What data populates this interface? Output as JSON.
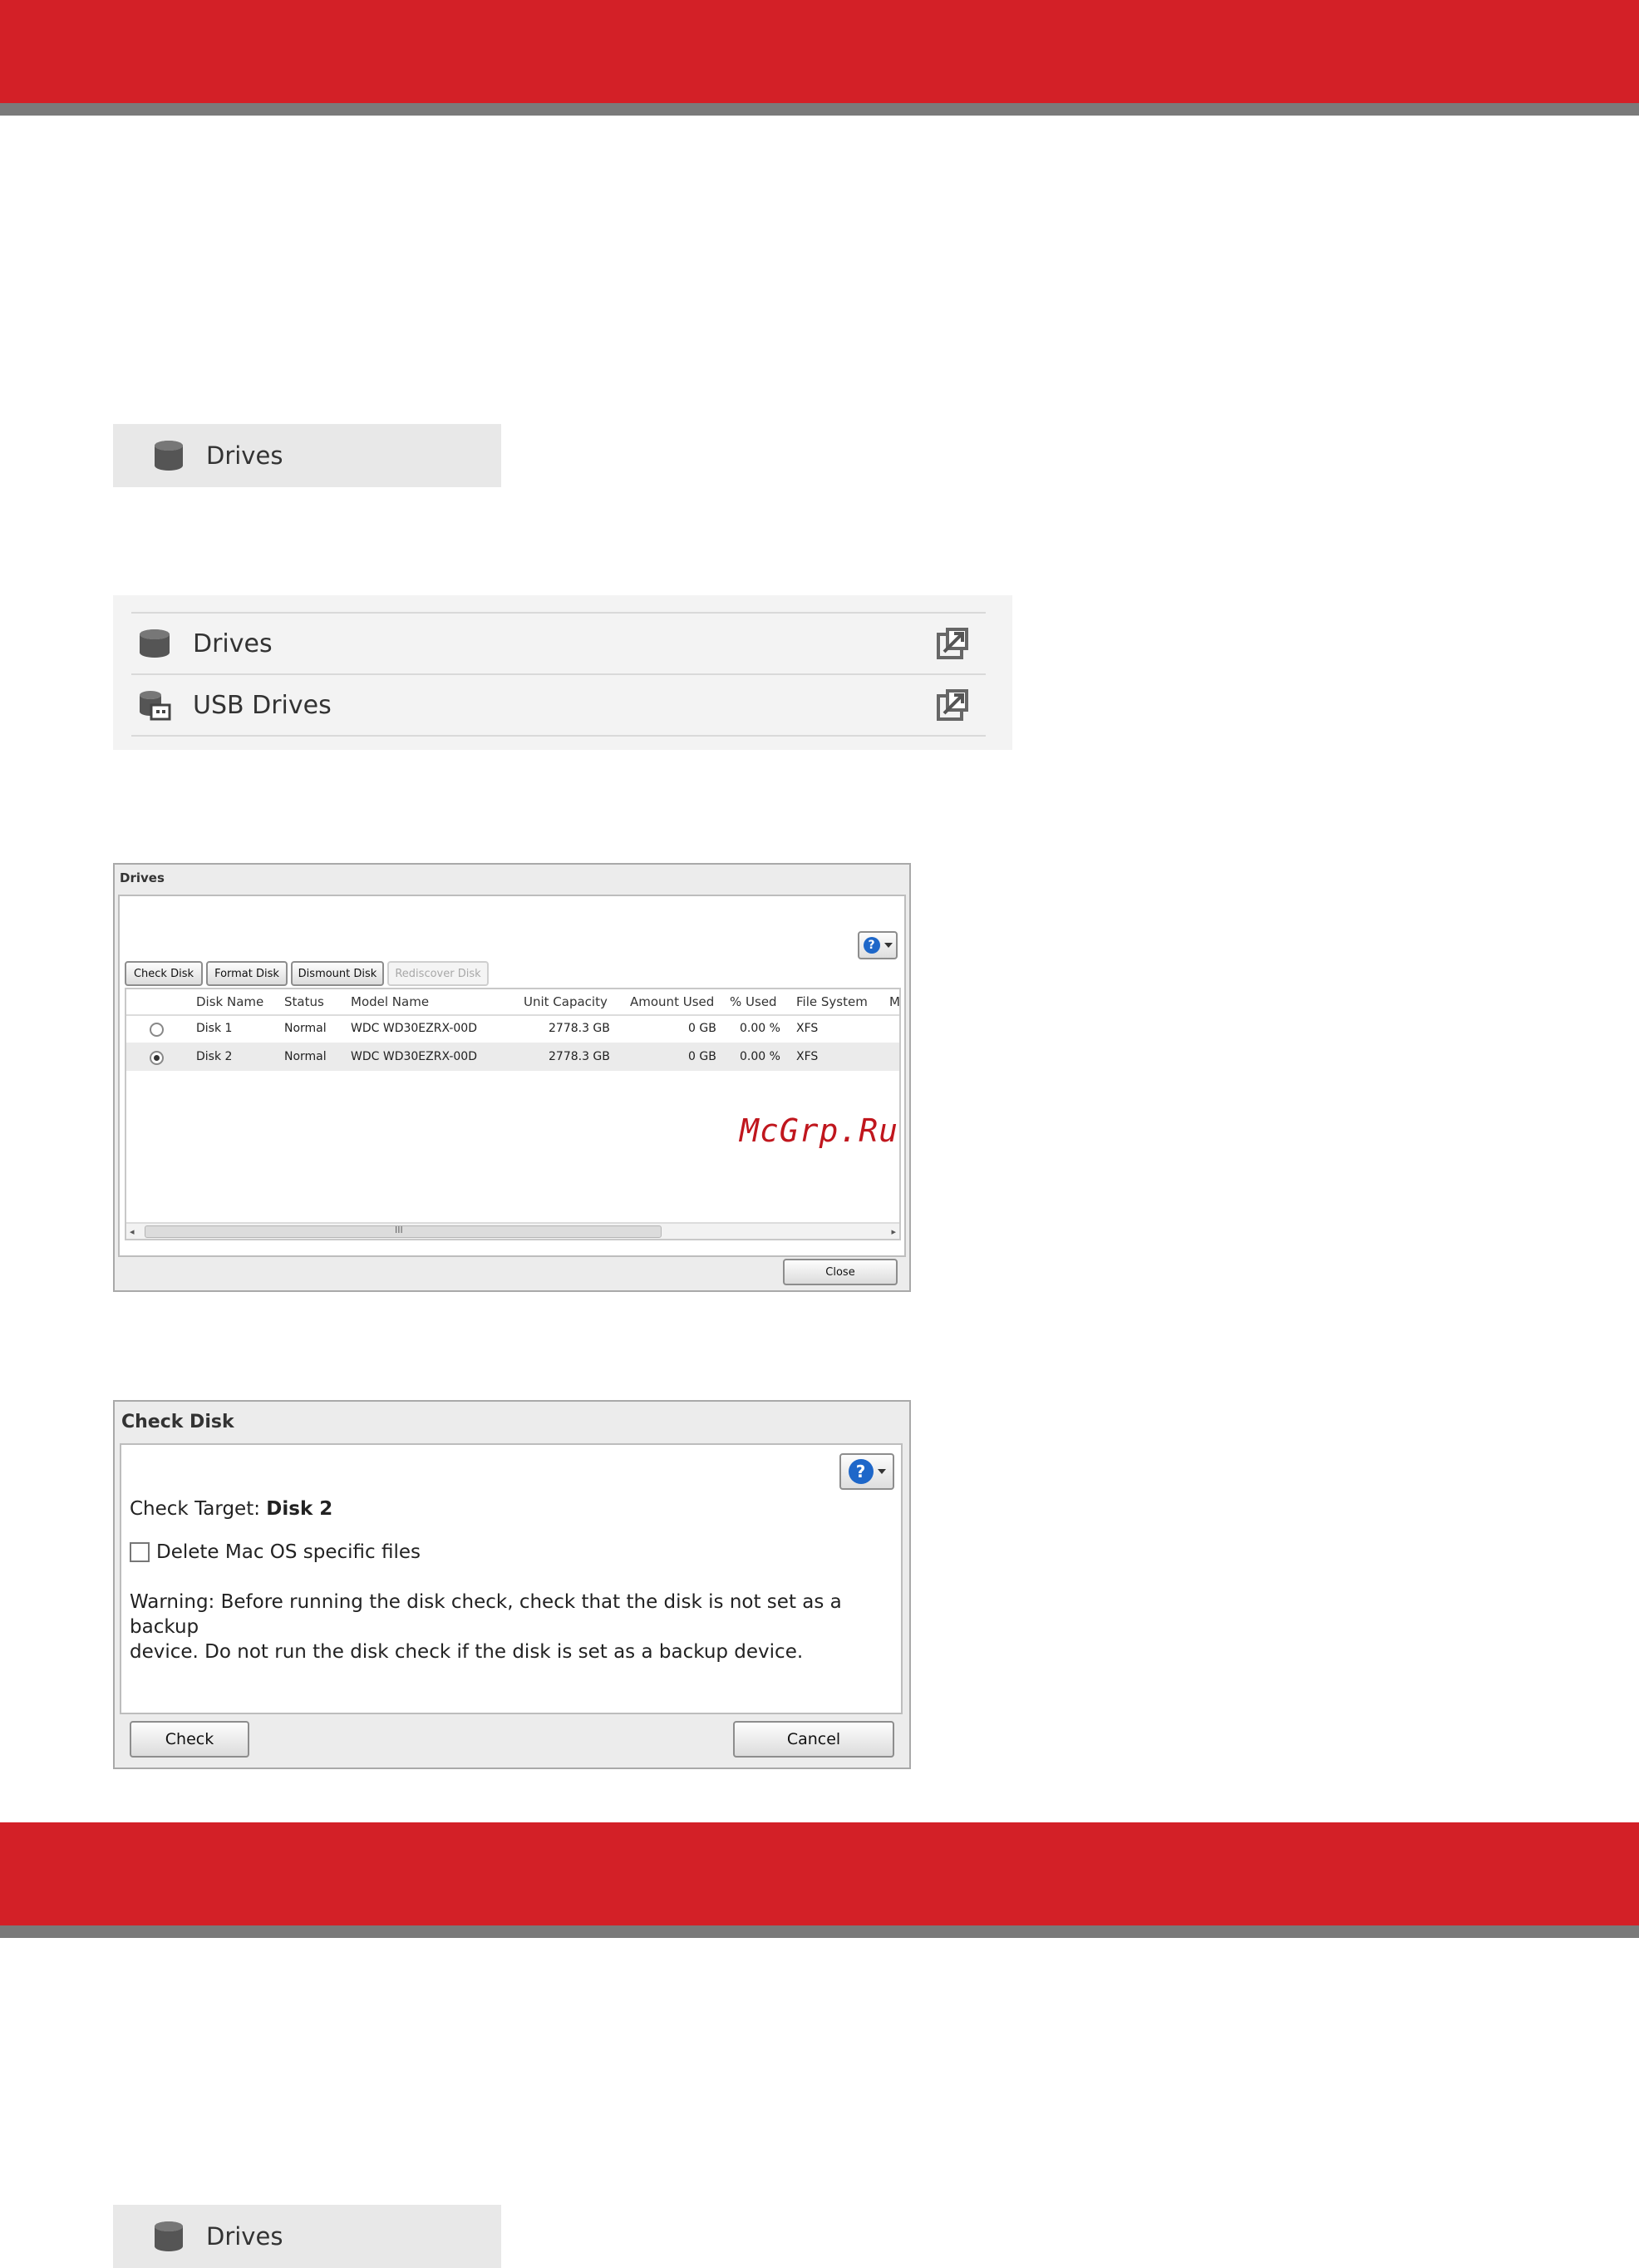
{
  "tile_top": {
    "label": "Drives",
    "icon": "database-icon"
  },
  "drive_list": [
    {
      "label": "Drives",
      "icon": "database-icon",
      "action_icon": "open-external-icon"
    },
    {
      "label": "USB Drives",
      "icon": "usb-drive-icon",
      "action_icon": "open-external-icon"
    }
  ],
  "drives_window": {
    "title": "Drives",
    "buttons": {
      "check": "Check Disk",
      "format": "Format Disk",
      "dismount": "Dismount Disk",
      "rediscover": "Rediscover Disk",
      "close": "Close"
    },
    "columns": [
      "Disk Name",
      "Status",
      "Model Name",
      "Unit Capacity",
      "Amount Used",
      "% Used",
      "File System",
      "M"
    ],
    "rows": [
      {
        "selected": false,
        "name": "Disk 1",
        "status": "Normal",
        "model": "WDC WD30EZRX-00D",
        "capacity": "2778.3 GB",
        "used": "0 GB",
        "pct": "0.00 %",
        "fs": "XFS"
      },
      {
        "selected": true,
        "name": "Disk 2",
        "status": "Normal",
        "model": "WDC WD30EZRX-00D",
        "capacity": "2778.3 GB",
        "used": "0 GB",
        "pct": "0.00 %",
        "fs": "XFS"
      }
    ],
    "scroll_marker": "III"
  },
  "watermark": "McGrp.Ru",
  "check_dialog": {
    "title": "Check Disk",
    "target_label": "Check Target:",
    "target_value": "Disk 2",
    "checkbox_label": "Delete Mac OS specific files",
    "checkbox_checked": false,
    "warning_line1": "Warning: Before running the disk check, check that the disk is not set as a backup",
    "warning_line2": "device. Do not run the disk check if the disk is set as a backup device.",
    "check_button": "Check",
    "cancel_button": "Cancel"
  },
  "tile_bottom": {
    "label": "Drives",
    "icon": "database-icon"
  },
  "colors": {
    "accent_red": "#d32027",
    "bar_gray": "#7a7a7a",
    "help_blue": "#1e67c9",
    "watermark_red": "#c0161d"
  }
}
